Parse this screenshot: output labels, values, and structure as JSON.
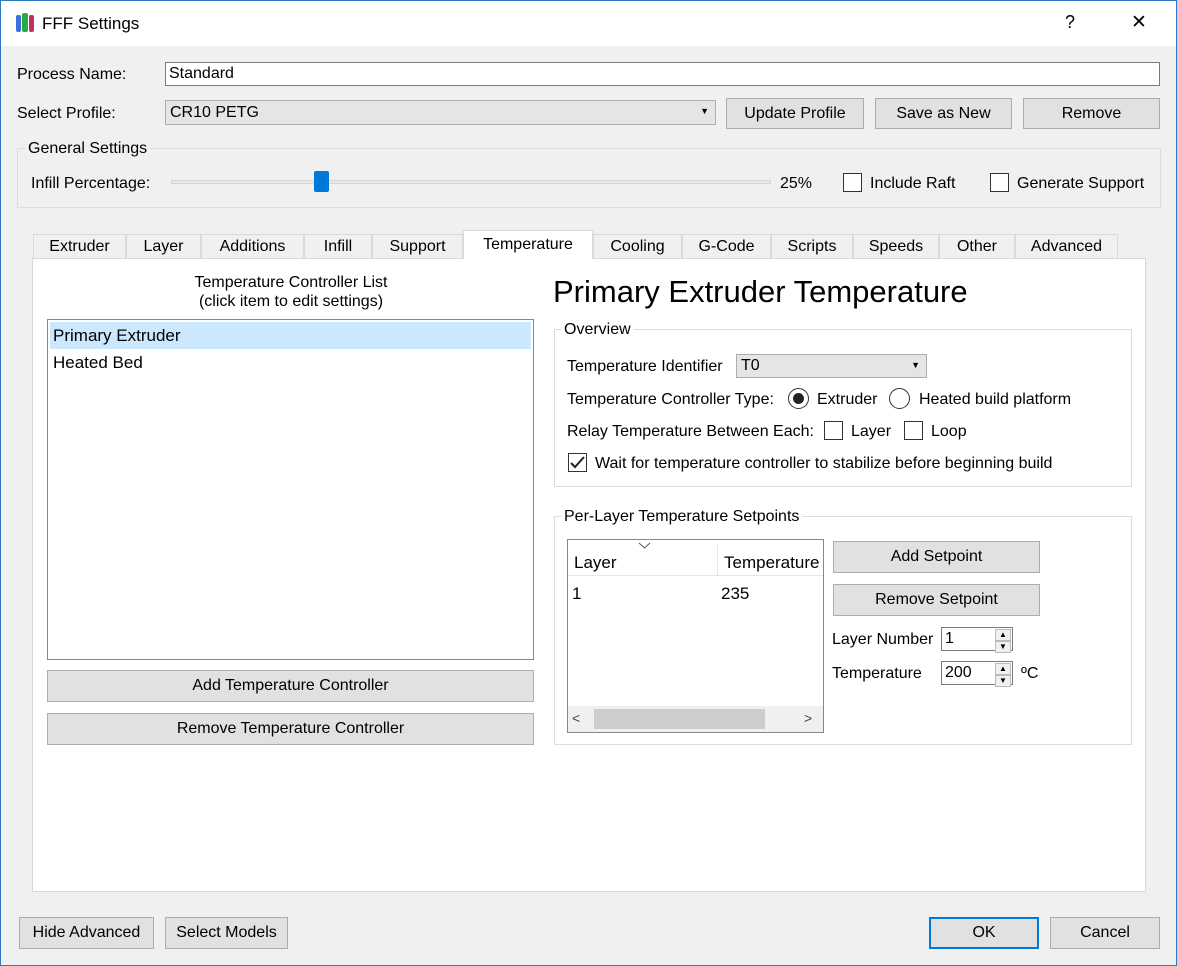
{
  "window": {
    "title": "FFF Settings",
    "help": "?",
    "close": "✕"
  },
  "process": {
    "label": "Process Name:",
    "value": "Standard"
  },
  "profile": {
    "label": "Select Profile:",
    "value": "CR10 PETG",
    "update": "Update Profile",
    "save_new": "Save as New",
    "remove": "Remove"
  },
  "general": {
    "title": "General Settings",
    "infill_label": "Infill Percentage:",
    "infill_percent": 25,
    "infill_text": "25%",
    "include_raft": "Include Raft",
    "generate_support": "Generate Support"
  },
  "tabs": [
    "Extruder",
    "Layer",
    "Additions",
    "Infill",
    "Support",
    "Temperature",
    "Cooling",
    "G-Code",
    "Scripts",
    "Speeds",
    "Other",
    "Advanced"
  ],
  "active_tab": "Temperature",
  "controllers": {
    "header_line1": "Temperature Controller List",
    "header_line2": "(click item to edit settings)",
    "items": [
      "Primary Extruder",
      "Heated Bed"
    ],
    "add": "Add Temperature Controller",
    "remove": "Remove Temperature Controller"
  },
  "detail": {
    "heading": "Primary Extruder Temperature",
    "overview": "Overview",
    "identifier_label": "Temperature Identifier",
    "identifier_value": "T0",
    "type_label": "Temperature Controller Type:",
    "type_extruder": "Extruder",
    "type_bed": "Heated build platform",
    "relay_label": "Relay Temperature Between Each:",
    "relay_layer": "Layer",
    "relay_loop": "Loop",
    "wait_label": "Wait for temperature controller to stabilize before beginning build"
  },
  "setpoints": {
    "title": "Per-Layer Temperature Setpoints",
    "col_layer": "Layer",
    "col_temp": "Temperature",
    "rows": [
      {
        "layer": "1",
        "temp": "235"
      }
    ],
    "add": "Add Setpoint",
    "remove": "Remove Setpoint",
    "layer_number_label": "Layer Number",
    "layer_number_value": "1",
    "temperature_label": "Temperature",
    "temperature_value": "200",
    "unit": "ºC"
  },
  "footer": {
    "hide_advanced": "Hide Advanced",
    "select_models": "Select Models",
    "ok": "OK",
    "cancel": "Cancel"
  },
  "colors": {
    "accent": "#0078d7",
    "selection": "#cce8ff"
  }
}
